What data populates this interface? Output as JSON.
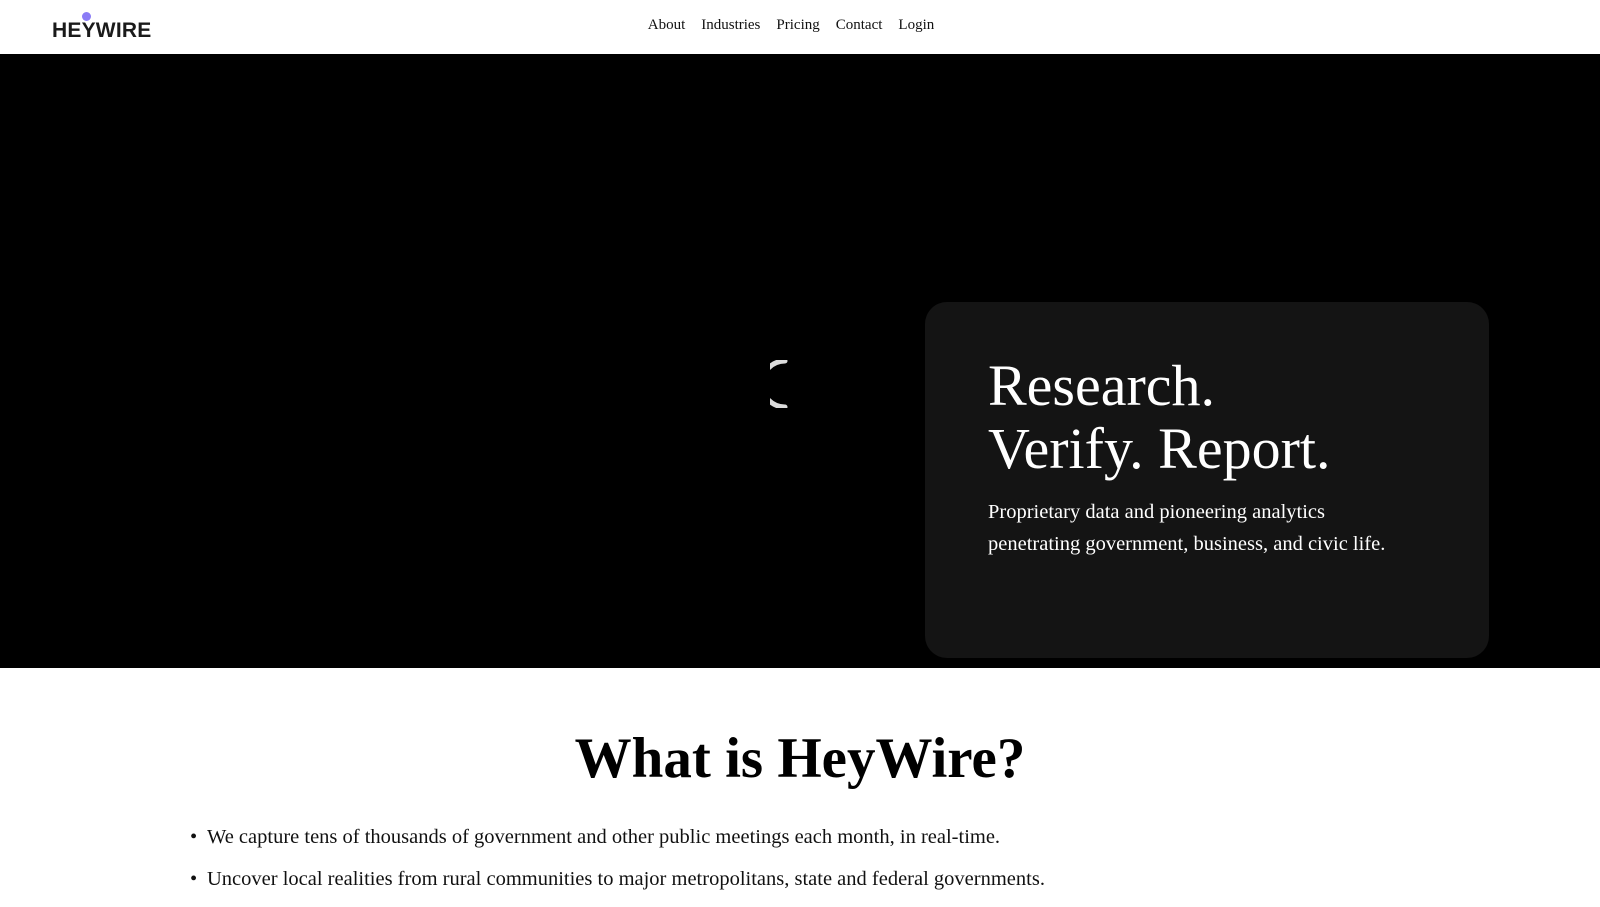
{
  "header": {
    "logo": {
      "text_part1": "HE",
      "text_part2": "Y",
      "text_part3": "WIRE",
      "dot_color": "#8b7cf6",
      "icon": "logo-dot"
    },
    "nav": [
      {
        "label": "About"
      },
      {
        "label": "Industries"
      },
      {
        "label": "Pricing"
      },
      {
        "label": "Contact"
      },
      {
        "label": "Login"
      }
    ]
  },
  "hero": {
    "background": "#000000",
    "spinner_icon": "loading-spinner-icon",
    "card": {
      "title_line1": "Research.",
      "title_line2": "Verify. Report.",
      "subtitle_line1": "Proprietary data and pioneering analytics",
      "subtitle_line2": "penetrating government, business, and civic life."
    }
  },
  "what": {
    "title": "What is HeyWire?",
    "bullets": [
      "We capture tens of thousands of government and other public meetings each month, in real-time.",
      "Uncover local realities from rural communities to major metropolitans, state and federal governments."
    ]
  }
}
